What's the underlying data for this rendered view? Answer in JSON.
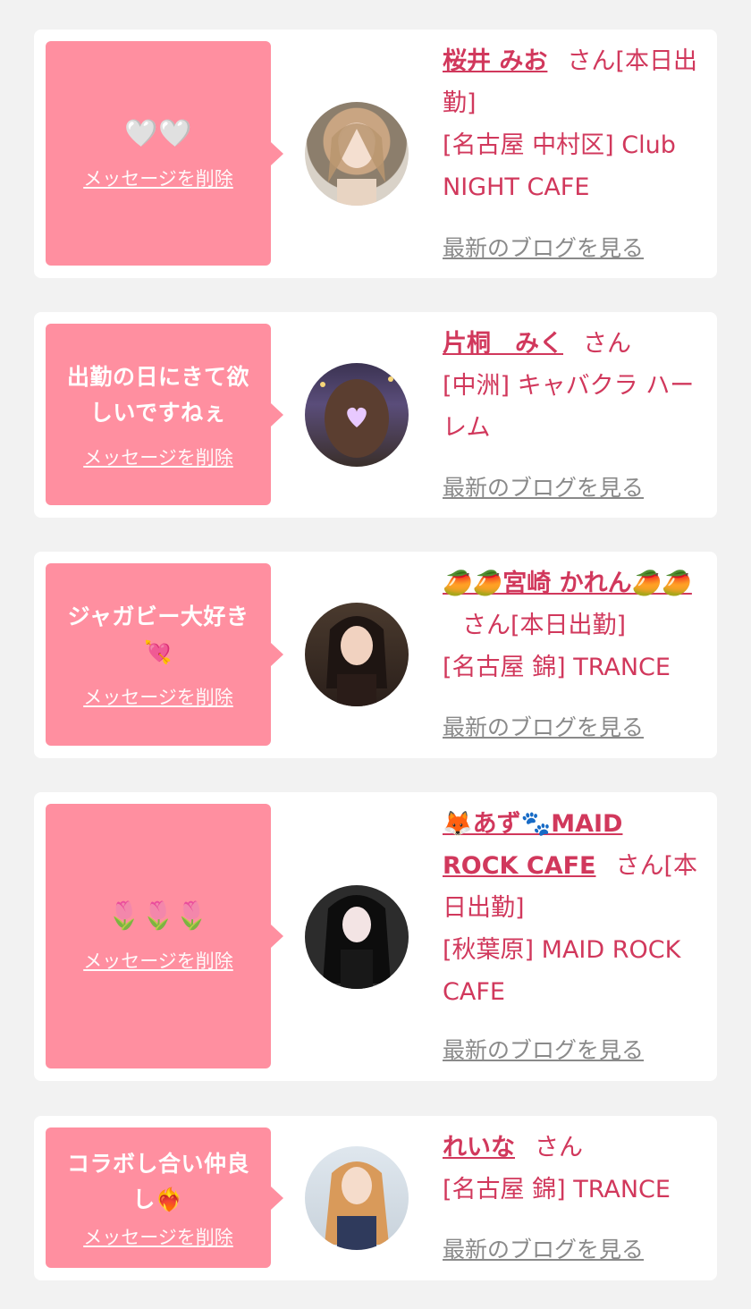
{
  "cards": [
    {
      "message": "🤍🤍",
      "delete_label": "メッセージを削除",
      "name": "桜井 みお",
      "suffix": "さん[本日出勤]",
      "shop": "[名古屋 中村区] Club NIGHT CAFE",
      "blog_label": "最新のブログを見る"
    },
    {
      "message": "出勤の日にきて欲しいですねぇ",
      "delete_label": "メッセージを削除",
      "name": "片桐　みく",
      "suffix": "さん",
      "shop": "[中洲] キャバクラ ハーレム",
      "blog_label": "最新のブログを見る"
    },
    {
      "message": "ジャガビー大好き💘",
      "delete_label": "メッセージを削除",
      "name": "🥭🥭宮崎 かれん🥭🥭",
      "suffix": "さん[本日出勤]",
      "shop": "[名古屋 錦] TRANCE",
      "blog_label": "最新のブログを見る"
    },
    {
      "message": "🌷🌷🌷",
      "delete_label": "メッセージを削除",
      "name": "🦊あず🐾MAID ROCK CAFE",
      "suffix": "さん[本日出勤]",
      "shop": "[秋葉原] MAID ROCK CAFE",
      "blog_label": "最新のブログを見る"
    },
    {
      "message": "コラボし合い仲良し❤️‍🔥",
      "delete_label": "メッセージを削除",
      "name": "れいな",
      "suffix": "さん",
      "shop": "[名古屋 錦] TRANCE",
      "blog_label": "最新のブログを見る"
    }
  ],
  "colors": {
    "page_bg": "#f2f2f2",
    "bubble": "#ff8fa0",
    "accent": "#d1385c",
    "muted": "#8a8a8a"
  },
  "icons": [
    "white-heart-icon",
    "mango-icon",
    "fox-icon",
    "paw-icon",
    "tulip-icon",
    "heart-on-fire-icon",
    "heart-with-ribbon-icon"
  ]
}
